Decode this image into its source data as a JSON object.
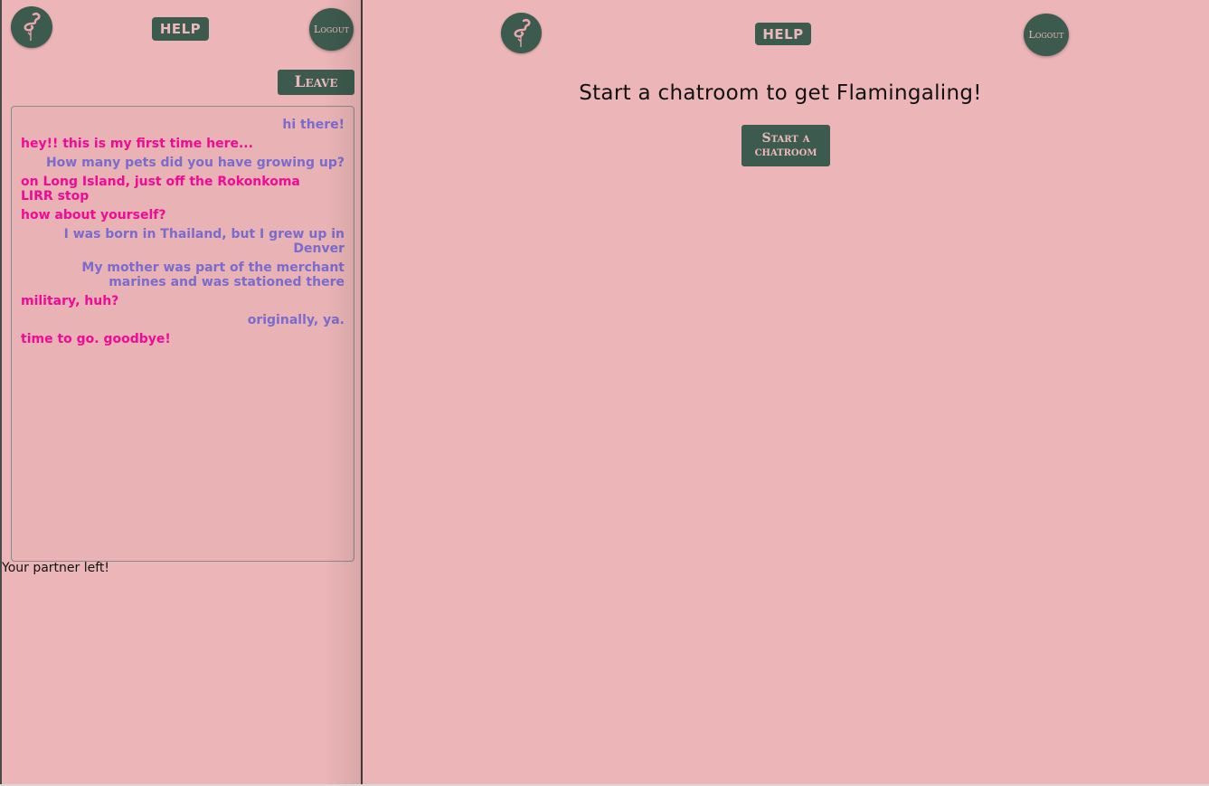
{
  "left": {
    "help_label": "HELP",
    "logout_label": "Logout",
    "leave_label": "Leave",
    "messages": [
      {
        "from": "me",
        "text": "hi there!"
      },
      {
        "from": "partner",
        "text": "hey!! this is my first time here..."
      },
      {
        "from": "me",
        "text": "How many pets did you have growing up?"
      },
      {
        "from": "partner",
        "text": "on Long Island, just off the Rokonkoma LIRR stop"
      },
      {
        "from": "partner",
        "text": "how about yourself?"
      },
      {
        "from": "me",
        "text": "I was born in Thailand, but I grew up in Denver"
      },
      {
        "from": "me",
        "text": "My mother was part of the merchant marines and was stationed there"
      },
      {
        "from": "partner",
        "text": "military, huh?"
      },
      {
        "from": "me",
        "text": "originally, ya."
      },
      {
        "from": "partner",
        "text": "time to go. goodbye!"
      }
    ],
    "status": "Your partner left!"
  },
  "right": {
    "help_label": "HELP",
    "logout_label": "Logout",
    "headline": "Start a chatroom to get Flamingaling!",
    "start_label": "Start a chatroom"
  },
  "colors": {
    "background": "#ecb5b7",
    "button": "#3d5a4e",
    "my_message": "#7a6bcc",
    "partner_message": "#f00a96"
  },
  "icons": {
    "logo": "flamingo-icon"
  }
}
